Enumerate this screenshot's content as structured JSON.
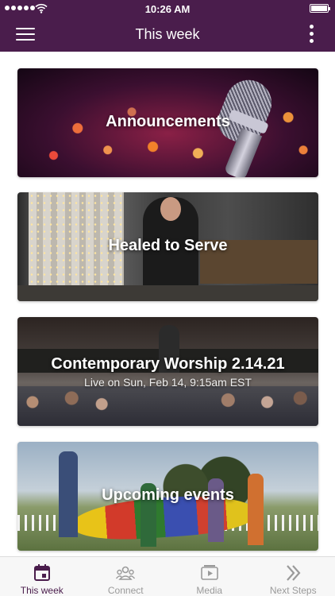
{
  "status_bar": {
    "time": "10:26 AM",
    "signal_icon": "signal-dots-icon",
    "wifi_icon": "wifi-icon",
    "battery_icon": "battery-icon",
    "battery_level": 1.0
  },
  "nav": {
    "title": "This week",
    "menu_icon": "hamburger-menu-icon",
    "more_icon": "more-vertical-icon"
  },
  "cards": [
    {
      "title": "Announcements"
    },
    {
      "title": "Healed to Serve"
    },
    {
      "title": "Contemporary Worship 2.14.21",
      "subtitle": "Live on Sun, Feb 14, 9:15am EST"
    },
    {
      "title": "Upcoming events"
    }
  ],
  "tabs": [
    {
      "label": "This week",
      "icon": "calendar-icon",
      "active": true
    },
    {
      "label": "Connect",
      "icon": "people-icon",
      "active": false
    },
    {
      "label": "Media",
      "icon": "media-play-icon",
      "active": false
    },
    {
      "label": "Next Steps",
      "icon": "double-chevron-right-icon",
      "active": false
    }
  ],
  "colors": {
    "header": "#4a1d4c",
    "active_tab": "#4a1d4c",
    "inactive_tab": "#9a9a9a"
  }
}
